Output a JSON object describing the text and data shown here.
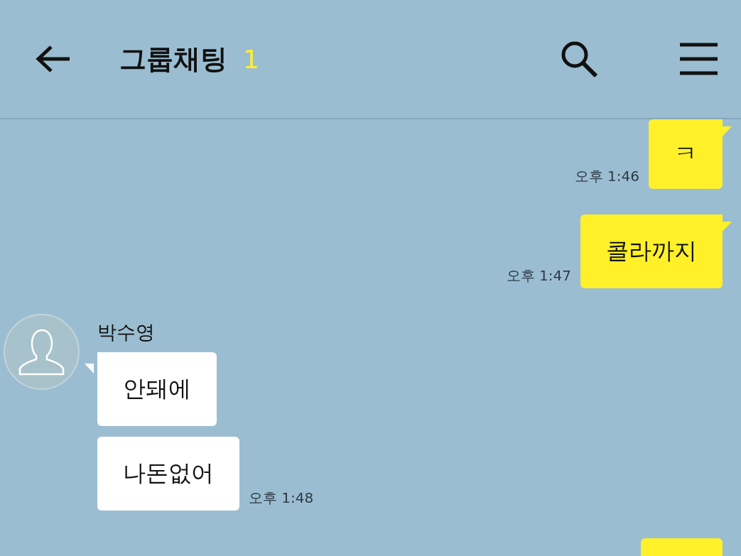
{
  "header": {
    "title": "그룹채팅",
    "member_count": "1"
  },
  "messages": [
    {
      "kind": "outgoing",
      "text": "ㅋ",
      "time": "오후 1:46",
      "tail": true
    },
    {
      "kind": "outgoing",
      "text": "콜라까지",
      "time": "오후 1:47",
      "tail": true
    },
    {
      "kind": "incoming",
      "sender": "박수영",
      "text": "안돼에",
      "tail": true
    },
    {
      "kind": "incoming",
      "text": "나돈없어",
      "time": "오후 1:48",
      "tail": false
    },
    {
      "kind": "outgoing",
      "tail": false
    }
  ]
}
